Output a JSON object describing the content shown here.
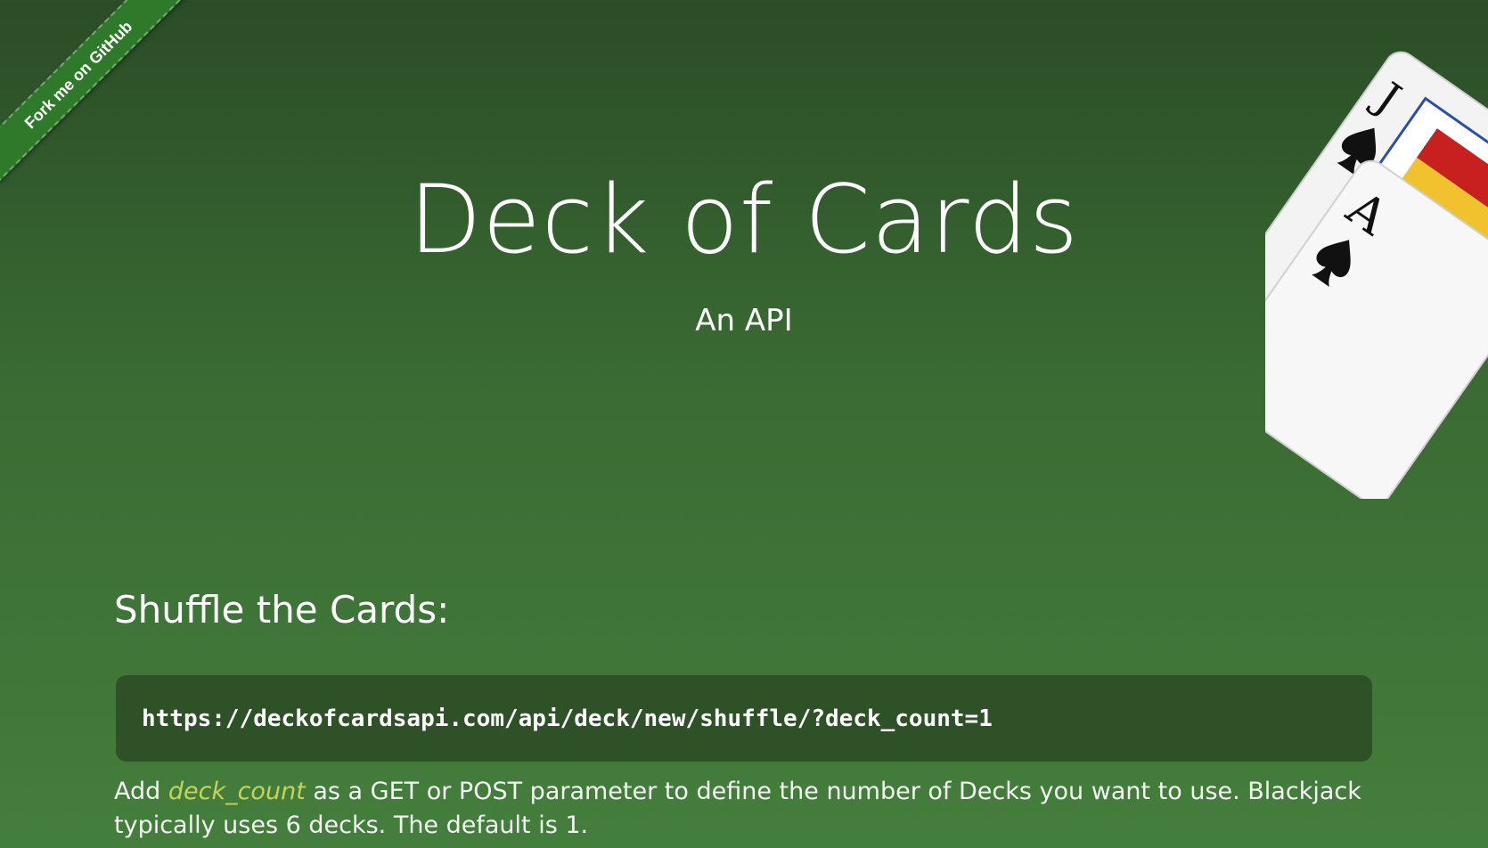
{
  "ribbon": {
    "label": "Fork me on GitHub"
  },
  "hero": {
    "title": "Deck of Cards",
    "subtitle": "An API"
  },
  "shuffle": {
    "heading": "Shuffle the Cards:",
    "url": "https://deckofcardsapi.com/api/deck/new/shuffle/?deck_count=1",
    "desc_before": "Add ",
    "param": "deck_count",
    "desc_after": " as a GET or POST parameter to define the number of Decks you want to use. Blackjack typically uses 6 decks. The default is 1."
  },
  "cards_art": {
    "cards": [
      {
        "rank": "J",
        "suit": "spade-icon"
      },
      {
        "rank": "A",
        "suit": "spade-icon"
      }
    ]
  },
  "colors": {
    "background_top": "#2b4c27",
    "background_bottom": "#447e3c",
    "code_box": "#2e5128",
    "param_highlight": "#c6d45a",
    "ribbon": "#2f7a2a"
  }
}
